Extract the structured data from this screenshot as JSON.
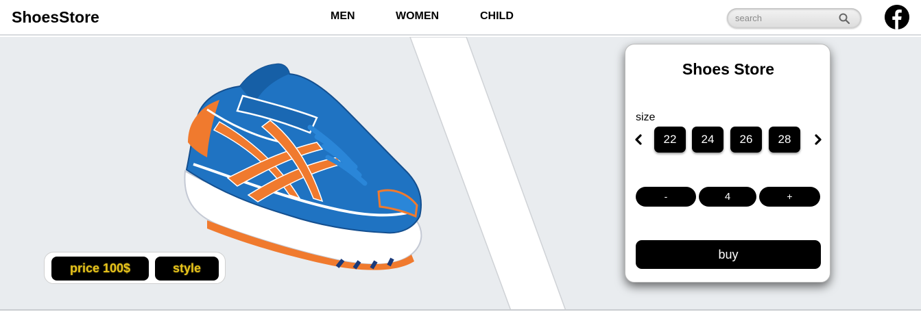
{
  "header": {
    "brand": "ShoesStore",
    "nav": [
      {
        "label": "MEN"
      },
      {
        "label": "WOMEN"
      },
      {
        "label": "CHILD"
      }
    ],
    "search": {
      "placeholder": "search",
      "value": ""
    },
    "social_icon": "facebook-icon"
  },
  "hero": {
    "product_image": "running-shoe-blue-orange",
    "price_label": "price 100$",
    "style_label": "style"
  },
  "card": {
    "title": "Shoes Store",
    "size_label": "size",
    "sizes": [
      "22",
      "24",
      "26",
      "28"
    ],
    "quantity": {
      "minus": "-",
      "value": "4",
      "plus": "+"
    },
    "buy_label": "buy"
  },
  "colors": {
    "background": "#e9ecef",
    "button": "#000000",
    "price_text": "#e7c31a",
    "shoe_primary": "#1f73c2",
    "shoe_accent": "#f07a2e"
  }
}
